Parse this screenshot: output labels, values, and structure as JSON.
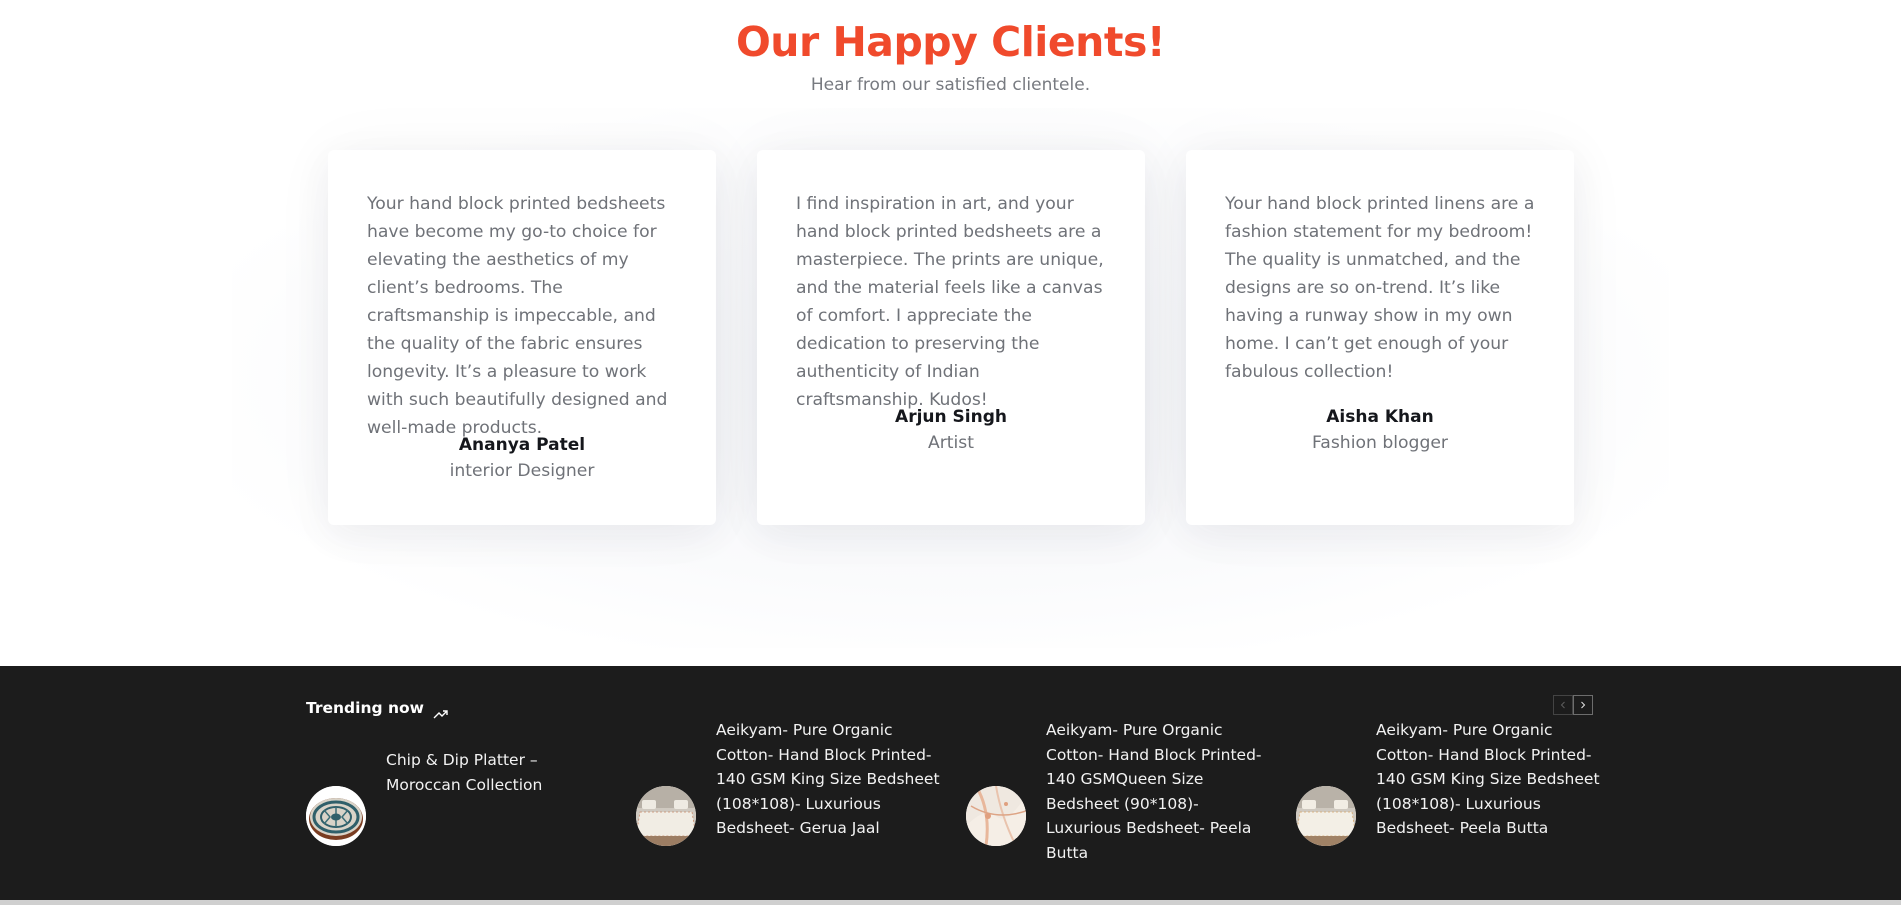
{
  "testimonials": {
    "title": "Our Happy Clients!",
    "subtitle": "Hear from our satisfied clientele.",
    "items": [
      {
        "quote": "Your hand block printed bedsheets have become my go-to choice for elevating the aesthetics of my client’s bedrooms. The craftsmanship is impeccable, and the quality of the fabric ensures longevity. It’s a pleasure to work with such beautifully designed and well-made products.",
        "name": "Ananya Patel",
        "role": "interior Designer"
      },
      {
        "quote": "I find inspiration in art, and your hand block printed bedsheets are a masterpiece. The prints are unique, and the material feels like a canvas of comfort. I appreciate the dedication to preserving the authenticity of Indian craftsmanship. Kudos!",
        "name": "Arjun Singh",
        "role": "Artist"
      },
      {
        "quote": "Your hand block printed linens are a fashion statement for my bedroom! The quality is unmatched, and the designs are so on-trend. It’s like having a runway show in my own home. I can’t get enough of your fabulous collection!",
        "name": "Aisha Khan",
        "role": "Fashion blogger"
      }
    ]
  },
  "trending": {
    "title": "Trending now",
    "icon": "trending-up-icon",
    "nav": {
      "prev_icon": "chevron-left-icon",
      "next_icon": "chevron-right-icon"
    },
    "products": [
      {
        "title": "Chip & Dip Platter – Moroccan Collection",
        "image": "platter-thumbnail"
      },
      {
        "title": "Aeikyam- Pure Organic Cotton- Hand Block Printed-140 GSM King Size Bedsheet (108*108)- Luxurious Bedsheet- Gerua Jaal",
        "image": "bedsheet-thumbnail"
      },
      {
        "title": "Aeikyam- Pure Organic Cotton- Hand Block Printed- 140 GSMQueen Size Bedsheet (90*108)- Luxurious Bedsheet- Peela Butta",
        "image": "fabric-thumbnail"
      },
      {
        "title": "Aeikyam- Pure Organic Cotton- Hand Block Printed- 140 GSM King Size Bedsheet (108*108)- Luxurious Bedsheet- Peela Butta",
        "image": "bedsheet-thumbnail"
      }
    ]
  },
  "colors": {
    "accent": "#f04a2c",
    "dark_band": "#1c1c1c",
    "body_text": "#6f7278"
  }
}
